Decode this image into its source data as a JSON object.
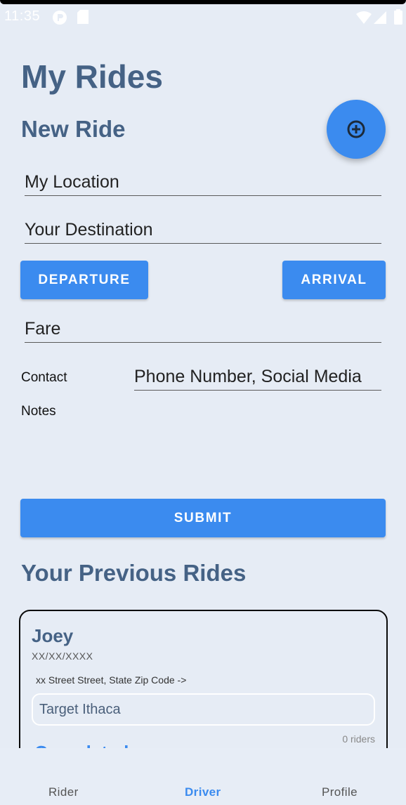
{
  "status_bar": {
    "time": "11:35"
  },
  "page": {
    "title": "My Rides"
  },
  "new_ride": {
    "heading": "New Ride",
    "location_placeholder": "My Location",
    "destination_placeholder": "Your Destination",
    "departure_label": "DEPARTURE",
    "arrival_label": "ARRIVAL",
    "fare_placeholder": "Fare",
    "contact_label": "Contact",
    "contact_placeholder": "Phone Number, Social Media",
    "notes_label": "Notes",
    "submit_label": "SUBMIT"
  },
  "previous": {
    "heading": "Your Previous Rides",
    "rides": [
      {
        "name": "Joey",
        "date": "XX/XX/XXXX",
        "address": "xx Street Street, State Zip Code ->",
        "destination": "Target Ithaca",
        "riders": "0 riders",
        "status": "Completed"
      }
    ]
  },
  "nav": {
    "rider": "Rider",
    "driver": "Driver",
    "profile": "Profile",
    "active": "Driver"
  },
  "colors": {
    "accent": "#3b8bef",
    "heading": "#456285",
    "background": "#e6ecf5"
  },
  "icons": {
    "fab": "add-circle-icon"
  }
}
